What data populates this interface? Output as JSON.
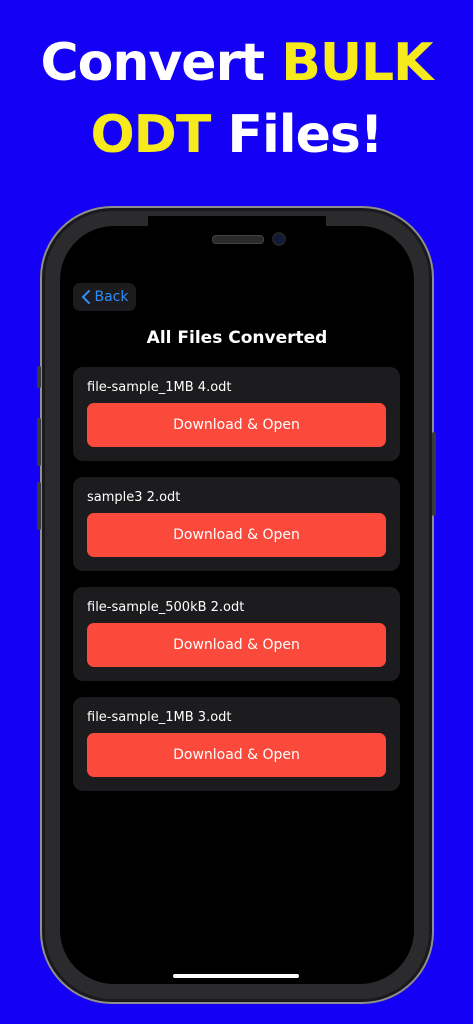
{
  "headline": {
    "line1_white": "Convert ",
    "line1_yellow": "BULK",
    "line2_yellow": "ODT",
    "line2_white": " Files!"
  },
  "nav": {
    "back_label": "Back"
  },
  "page_title": "All Files Converted",
  "files": [
    {
      "name": "file-sample_1MB 4.odt",
      "action": "Download & Open"
    },
    {
      "name": "sample3 2.odt",
      "action": "Download & Open"
    },
    {
      "name": "file-sample_500kB 2.odt",
      "action": "Download & Open"
    },
    {
      "name": "file-sample_1MB 3.odt",
      "action": "Download & Open"
    }
  ],
  "colors": {
    "background": "#1400f5",
    "headline_accent": "#f6ea1d",
    "button": "#fb4a3c",
    "back_text": "#2f8cf6"
  },
  "icons": {
    "back": "chevron-left-icon"
  }
}
